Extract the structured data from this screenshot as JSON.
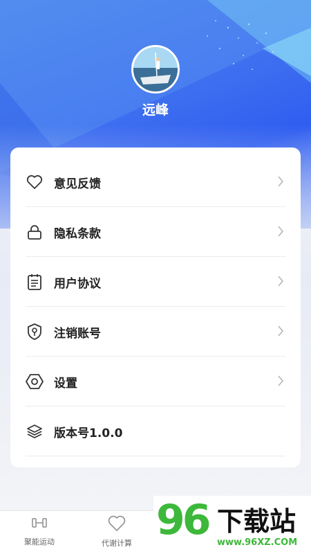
{
  "profile": {
    "username": "远峰"
  },
  "menu": [
    {
      "label": "意见反馈",
      "icon": "heart-icon",
      "has_chevron": true
    },
    {
      "label": "隐私条款",
      "icon": "lock-icon",
      "has_chevron": true
    },
    {
      "label": "用户协议",
      "icon": "document-icon",
      "has_chevron": true
    },
    {
      "label": "注销账号",
      "icon": "shield-key-icon",
      "has_chevron": true
    },
    {
      "label": "设置",
      "icon": "settings-hexagon-icon",
      "has_chevron": true
    },
    {
      "label": "版本号1.0.0",
      "icon": "layers-icon",
      "has_chevron": false
    }
  ],
  "tabs": [
    {
      "label": "聚能运动",
      "icon": "dumbbell-icon"
    },
    {
      "label": "代谢计算",
      "icon": "heart-outline-icon"
    }
  ],
  "watermark": {
    "number": "96",
    "title": "下载站",
    "url": "www.96XZ.COM"
  },
  "colors": {
    "accent": "#3f6ff0",
    "watermark_green": "#3db83a"
  }
}
